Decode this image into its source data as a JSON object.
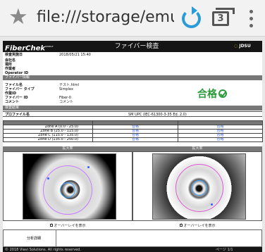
{
  "browser": {
    "url": "file:///storage/emulated",
    "tab_count": "3"
  },
  "report": {
    "brand": "FiberChek",
    "brand_super": "MOBILE",
    "title": "ファイバー検査",
    "logo": "JDSU",
    "info": [
      {
        "label": "検査実施日",
        "value": "2018/05/21 15:40"
      },
      {
        "label": "会社名",
        "value": ""
      },
      {
        "label": "場所",
        "value": ""
      },
      {
        "label": "作業者",
        "value": ""
      },
      {
        "label": "Operator ID",
        "value": ""
      }
    ],
    "fiber_section": "ファイバー情報",
    "fiber": [
      {
        "label": "ファイル名",
        "value": "テスト.html"
      },
      {
        "label": "ファイバー タイプ",
        "value": "Simplex"
      },
      {
        "label": "作業ID",
        "value": ""
      },
      {
        "label": "ファイバー ID",
        "value": "Fiber-0"
      },
      {
        "label": "コメント",
        "value": "コメント"
      }
    ],
    "pass_text": "合格",
    "results_section": "検査結果",
    "profile_label": "プロファイル名",
    "profile_value": "SM UPC (IEC-61300-3-35 Ed. 2.0)",
    "zones": [
      {
        "name": "Zone A (0.0 - 25.0)",
        "left": "合格",
        "right": "合格"
      },
      {
        "name": "Zone B (25.0 - 115.0)",
        "left": "合格",
        "right": "合格"
      },
      {
        "name": "Zone C (115.0 - 135.0)",
        "left": "合格",
        "right": "合格"
      },
      {
        "name": "Zone D (135.0 - 250.0)",
        "left": "合格",
        "right": "合格"
      }
    ],
    "image_heads": [
      "拡大率",
      "拡大率"
    ],
    "overlay_label": "オーバーレイを表示",
    "analysis_label": "分析詳細",
    "footer": "© 2018 Viavi Solutions. All rights reserved.",
    "footer_right": "ページ 1/1",
    "colors": {
      "pass": "#2a9b3b",
      "link": "#315fff",
      "header": "#151515"
    }
  }
}
